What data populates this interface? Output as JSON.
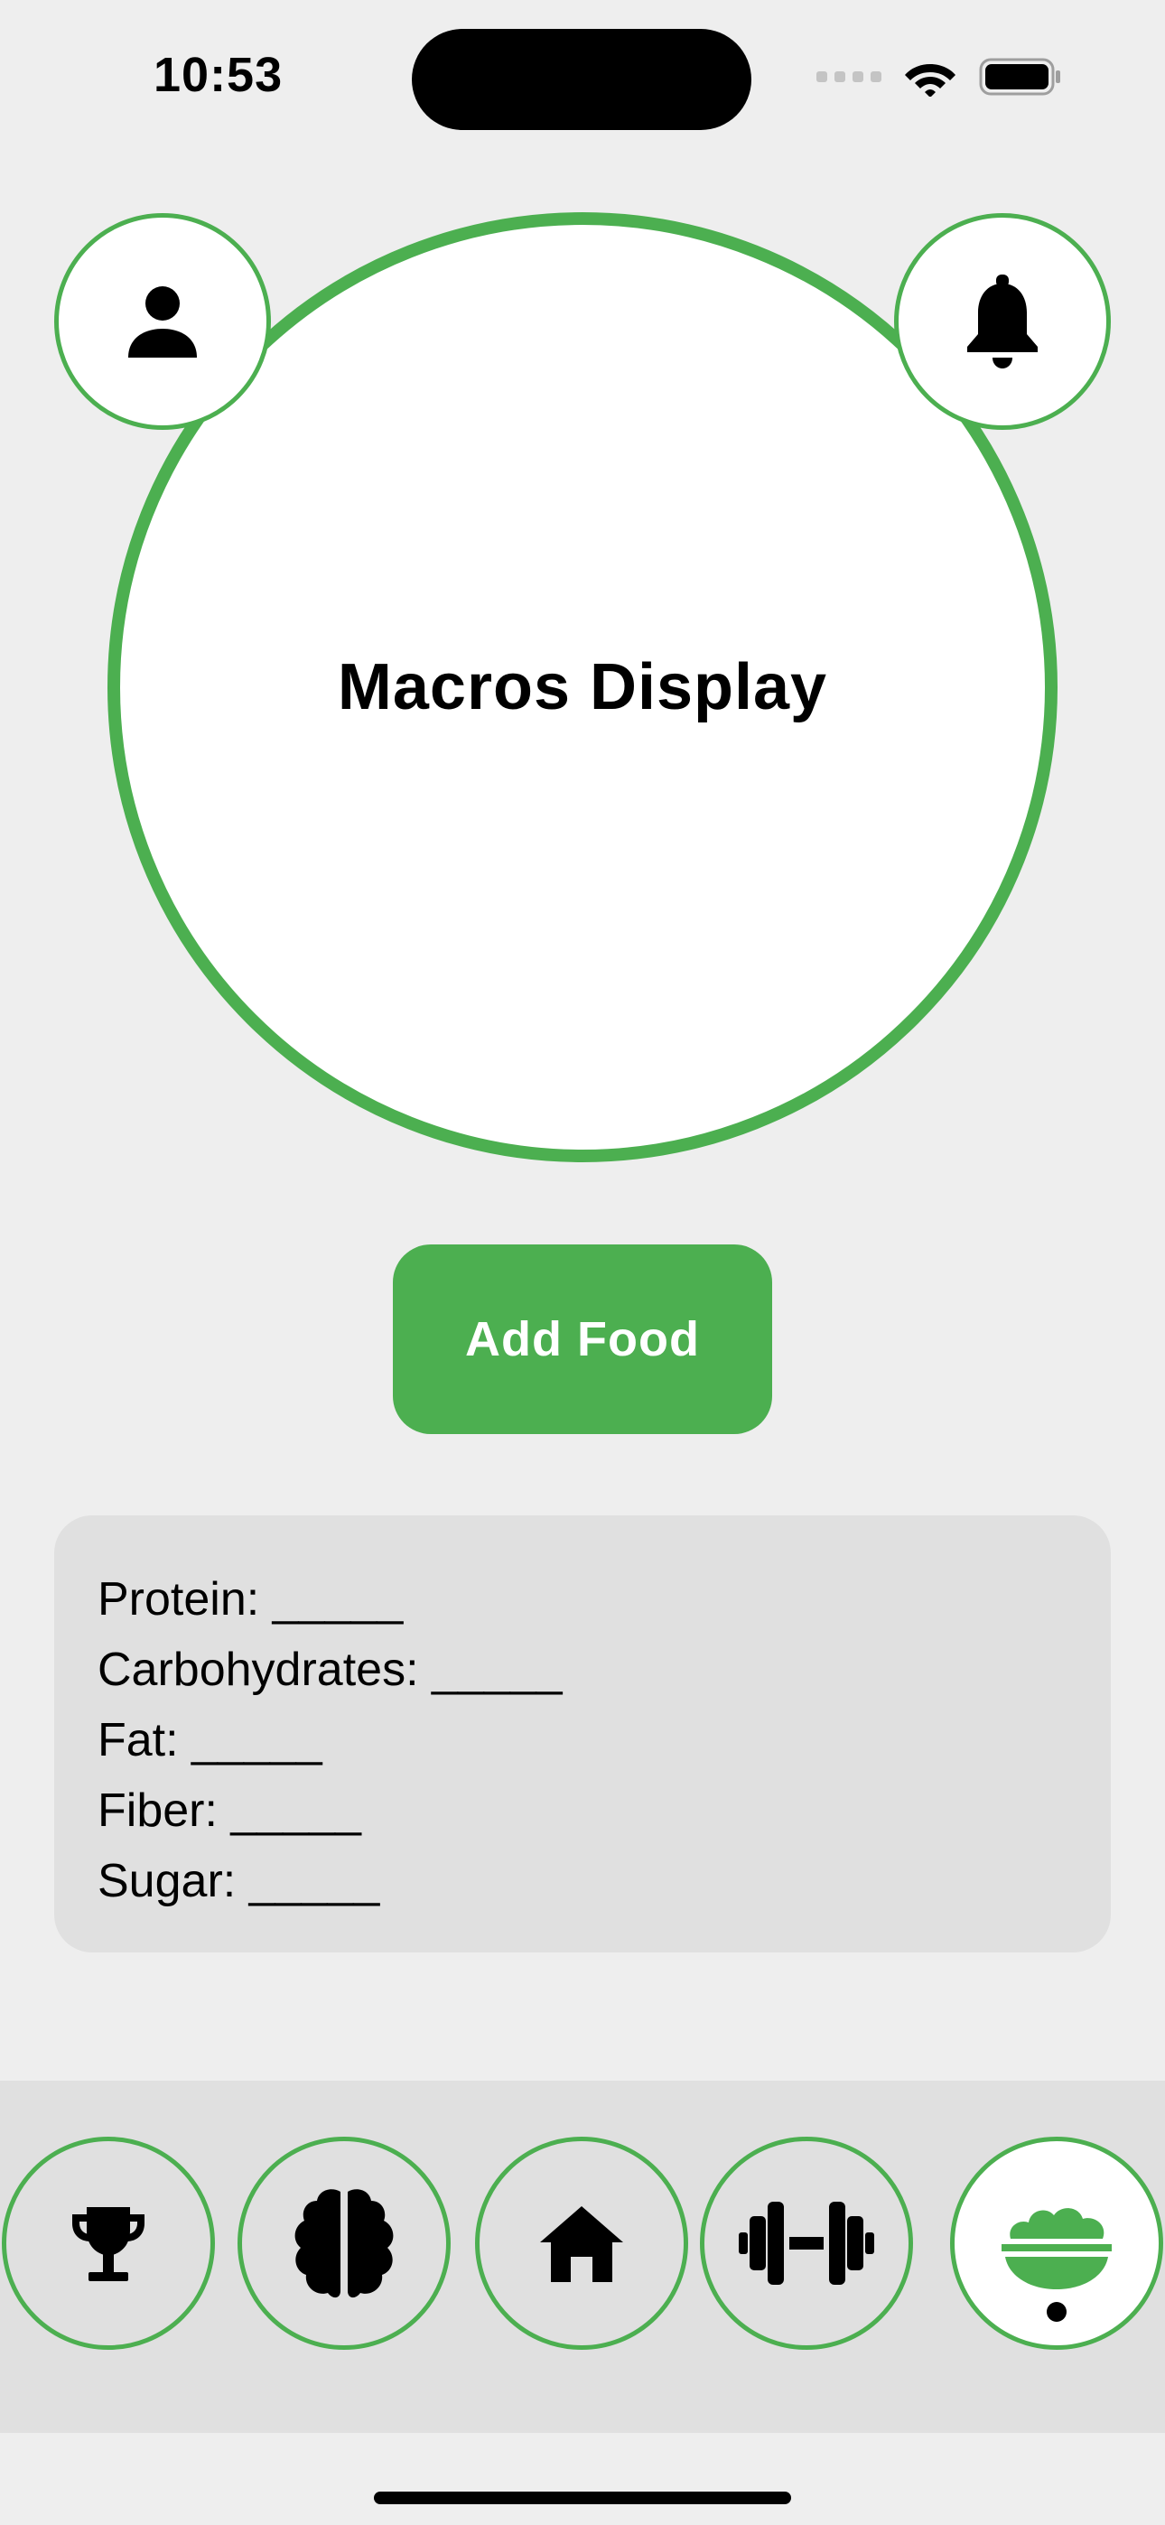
{
  "status_bar": {
    "time": "10:53",
    "icons": [
      "signal-icon",
      "wifi-icon",
      "battery-icon"
    ]
  },
  "header": {
    "profile_icon": "person-icon",
    "notification_icon": "bell-icon"
  },
  "macros_display": {
    "title": "Macros Display"
  },
  "add_food": {
    "label": "Add Food"
  },
  "macros_list": [
    {
      "label": "Protein: _____"
    },
    {
      "label": "Carbohydrates: _____"
    },
    {
      "label": "Fat: _____"
    },
    {
      "label": "Fiber: _____"
    },
    {
      "label": "Sugar: _____"
    }
  ],
  "bottom_nav": {
    "items": [
      {
        "icon": "trophy-icon",
        "active": false
      },
      {
        "icon": "brain-icon",
        "active": false
      },
      {
        "icon": "home-icon",
        "active": false
      },
      {
        "icon": "dumbbell-icon",
        "active": false
      },
      {
        "icon": "food-bowl-icon",
        "active": true
      }
    ]
  },
  "colors": {
    "accent": "#4caf50",
    "background": "#eeeeee",
    "card": "#e0e0e0",
    "text": "#000000"
  }
}
